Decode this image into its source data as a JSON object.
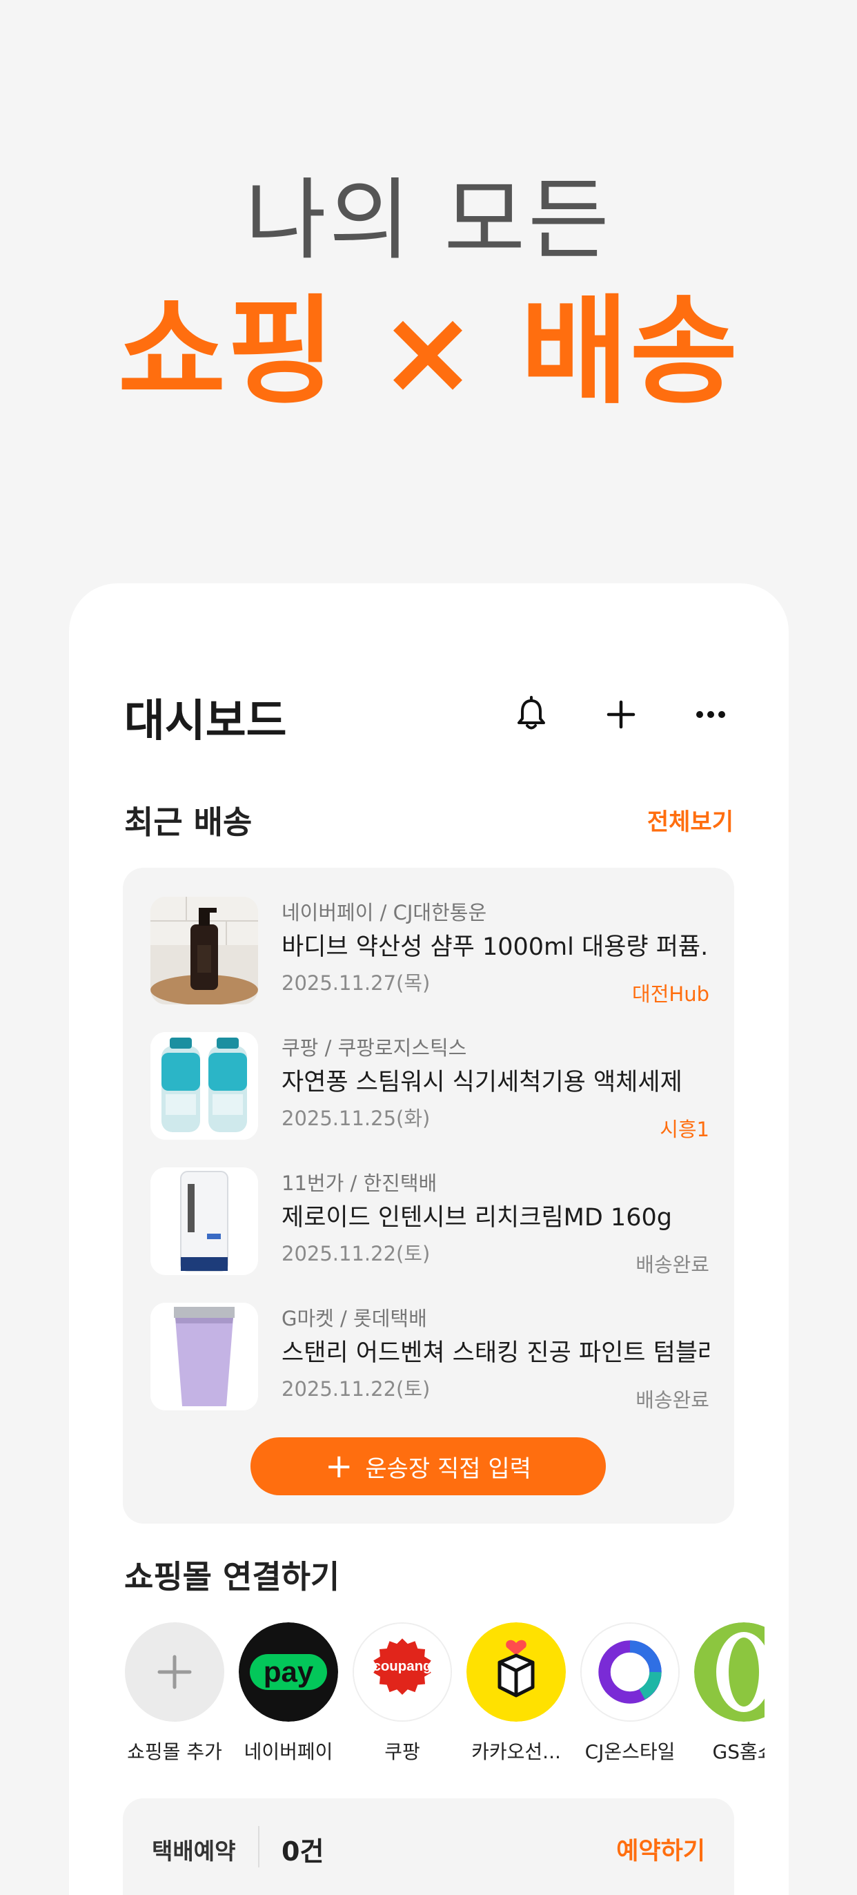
{
  "hero": {
    "line1": "나의 모든",
    "line2": "쇼핑 × 배송"
  },
  "dashboard": {
    "title": "대시보드",
    "icons": [
      "bell-icon",
      "plus-icon",
      "more-icon"
    ]
  },
  "recent": {
    "title": "최근 배송",
    "see_all": "전체보기",
    "items": [
      {
        "source": "네이버페이 / CJ대한통운",
        "name": "바디브 약산성 샴푸 1000ml 대용량 퍼퓸...",
        "date": "2025.11.27(목)",
        "status": "대전Hub",
        "status_color": "#ff6e0f"
      },
      {
        "source": "쿠팡 / 쿠팡로지스틱스",
        "name": "자연퐁 스팀워시 식기세척기용 액체세제",
        "date": "2025.11.25(화)",
        "status": "시흥1",
        "status_color": "#ff6e0f"
      },
      {
        "source": "11번가 / 한진택배",
        "name": "제로이드 인텐시브 리치크림MD 160g",
        "date": "2025.11.22(토)",
        "status": "배송완료",
        "status_color": "#8a8a8a"
      },
      {
        "source": "G마켓 / 롯데택배",
        "name": "스탠리 어드벤쳐 스태킹 진공 파인트 텀블러",
        "date": "2025.11.22(토)",
        "status": "배송완료",
        "status_color": "#8a8a8a"
      }
    ],
    "manual_button": "운송장 직접 입력"
  },
  "connect": {
    "title": "쇼핑몰 연결하기",
    "malls": [
      {
        "label": "쇼핑몰 추가",
        "logo": "add-icon"
      },
      {
        "label": "네이버페이",
        "logo": "naverpay-logo"
      },
      {
        "label": "쿠팡",
        "logo": "coupang-logo"
      },
      {
        "label": "카카오선...",
        "logo": "kakao-gift-logo"
      },
      {
        "label": "CJ온스타일",
        "logo": "cjonstyle-logo"
      },
      {
        "label": "GS홈쇼",
        "logo": "gsshop-logo"
      }
    ],
    "naverpay_text": "pay",
    "coupang_text": "coupang"
  },
  "reserve": {
    "label": "택배예약",
    "count": "0건",
    "action": "예약하기"
  },
  "colors": {
    "accent": "#ff6e0f",
    "background": "#f5f5f5",
    "card": "#f4f4f4"
  }
}
